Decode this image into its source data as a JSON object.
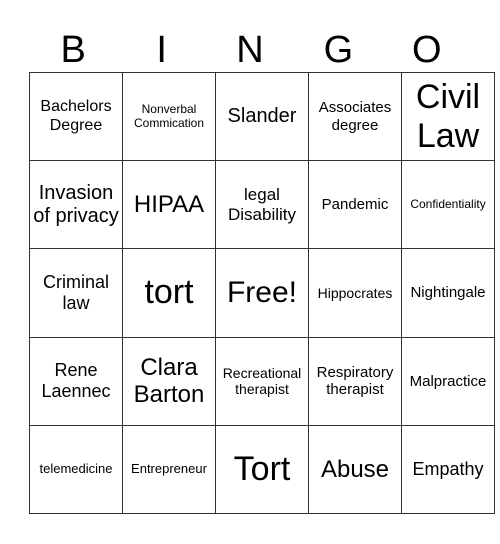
{
  "header": {
    "letters": [
      "B",
      "I",
      "N",
      "G",
      "O"
    ]
  },
  "board": {
    "rows": [
      [
        "Bachelors Degree",
        "Nonverbal Commication",
        "Slander",
        "Associates degree",
        "Civil Law"
      ],
      [
        "Invasion of privacy",
        "HIPAA",
        "legal Disability",
        "Pandemic",
        "Confidentiality"
      ],
      [
        "Criminal law",
        "tort",
        "Free!",
        "Hippocrates",
        "Nightingale"
      ],
      [
        "Rene Laennec",
        "Clara Barton",
        "Recreational therapist",
        "Respiratory therapist",
        "Malpractice"
      ],
      [
        "telemedicine",
        "Entrepreneur",
        "Tort",
        "Abuse",
        "Empathy"
      ]
    ]
  }
}
